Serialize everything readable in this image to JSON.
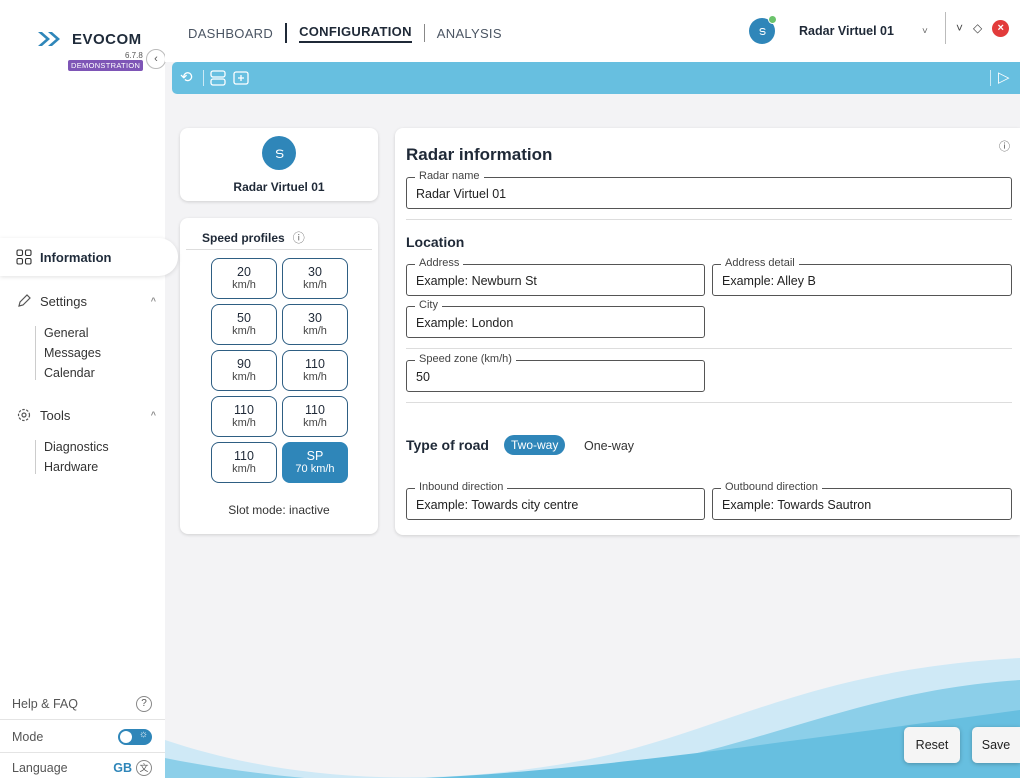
{
  "app": {
    "name": "EVOCOM",
    "version": "6.7.8",
    "badge": "DEMONSTRATION",
    "accent_color": "#2f86b9",
    "toolbar_color": "#67bfe0",
    "badge_color": "#7e55b6"
  },
  "sidebar": {
    "active_item": {
      "label": "Information",
      "icon": "grid-icon"
    },
    "settings": {
      "label": "Settings",
      "icon": "pencil-icon",
      "items": [
        "General",
        "Messages",
        "Calendar"
      ]
    },
    "tools": {
      "label": "Tools",
      "icon": "gear-icon",
      "items": [
        "Diagnostics",
        "Hardware"
      ]
    },
    "footer": {
      "help_label": "Help & FAQ",
      "mode_label": "Mode",
      "language_label": "Language",
      "language_value": "GB"
    }
  },
  "header": {
    "tabs": [
      "DASHBOARD",
      "CONFIGURATION",
      "ANALYSIS"
    ],
    "active_tab": "CONFIGURATION",
    "radar_selected": "Radar Virtuel 01"
  },
  "radar_card": {
    "name": "Radar Virtuel 01"
  },
  "speed_profiles": {
    "title": "Speed profiles",
    "items": [
      {
        "value": "20",
        "unit": "km/h"
      },
      {
        "value": "30",
        "unit": "km/h"
      },
      {
        "value": "50",
        "unit": "km/h"
      },
      {
        "value": "30",
        "unit": "km/h"
      },
      {
        "value": "90",
        "unit": "km/h"
      },
      {
        "value": "110",
        "unit": "km/h"
      },
      {
        "value": "110",
        "unit": "km/h"
      },
      {
        "value": "110",
        "unit": "km/h"
      },
      {
        "value": "110",
        "unit": "km/h"
      },
      {
        "value": "SP",
        "unit": "70 km/h",
        "selected": true
      }
    ],
    "slot_mode_label": "Slot mode:",
    "slot_mode_value": "inactive"
  },
  "info": {
    "title": "Radar information",
    "radar_name_label": "Radar name",
    "radar_name_value": "Radar Virtuel 01",
    "location_title": "Location",
    "address_label": "Address",
    "address_placeholder": "Example: Newburn St",
    "address_detail_label": "Address detail",
    "address_detail_placeholder": "Example: Alley B",
    "city_label": "City",
    "city_placeholder": "Example: London",
    "speed_zone_label": "Speed zone (km/h)",
    "speed_zone_value": "50",
    "road_title": "Type of road",
    "road_options": [
      "Two-way",
      "One-way"
    ],
    "road_selected": "Two-way",
    "inbound_label": "Inbound direction",
    "inbound_placeholder": "Example: Towards city centre",
    "outbound_label": "Outbound direction",
    "outbound_placeholder": "Example: Towards Sautron"
  },
  "actions": {
    "reset": "Reset",
    "save": "Save"
  }
}
